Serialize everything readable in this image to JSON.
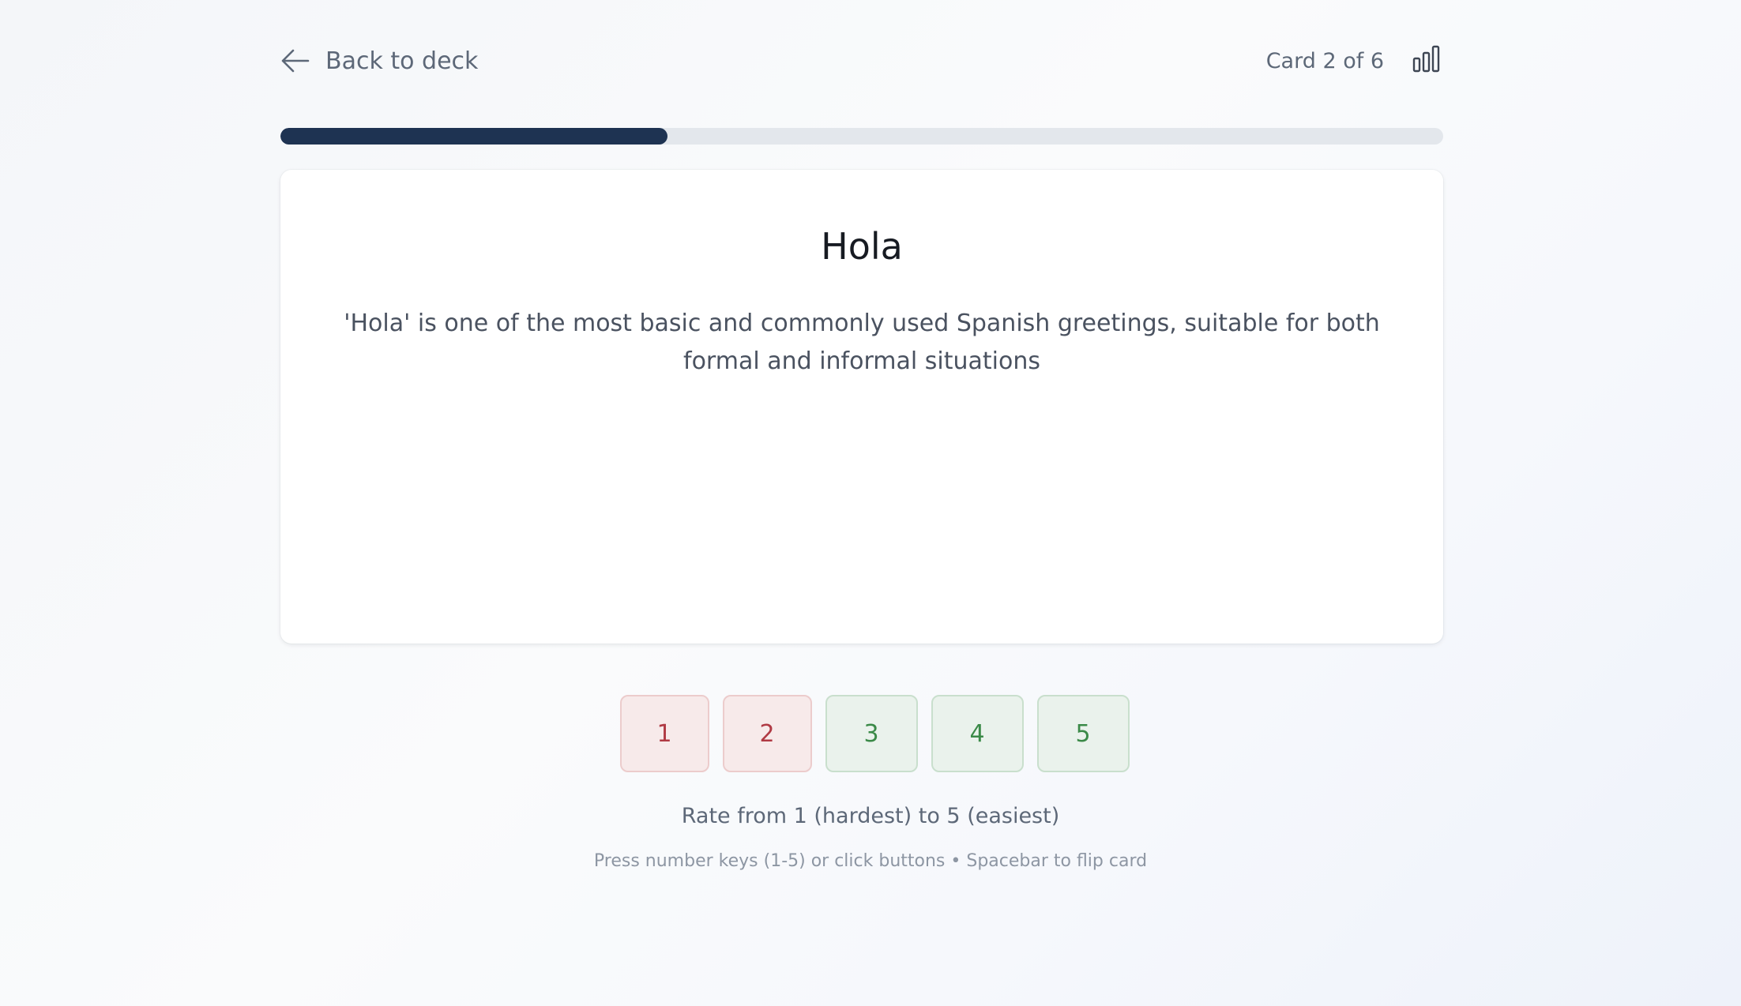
{
  "header": {
    "back_label": "Back to deck",
    "card_counter": "Card 2 of 6",
    "stats_icon": "bar-chart-icon",
    "back_icon": "arrow-left-icon"
  },
  "progress": {
    "current": 2,
    "total": 6,
    "fraction": 0.333
  },
  "card": {
    "term": "Hola",
    "definition": "'Hola' is one of the most basic and commonly used Spanish greetings, suitable for both formal and informal situations"
  },
  "rating": {
    "buttons": [
      {
        "label": "1",
        "tone": "hard"
      },
      {
        "label": "2",
        "tone": "hard"
      },
      {
        "label": "3",
        "tone": "easy"
      },
      {
        "label": "4",
        "tone": "easy"
      },
      {
        "label": "5",
        "tone": "easy"
      }
    ],
    "caption": "Rate from 1 (hardest) to 5 (easiest)",
    "hint": "Press number keys (1-5) or click buttons • Spacebar to flip card"
  },
  "colors": {
    "progress_fill": "#1e3352",
    "progress_track": "#e3e7ec",
    "hard_text": "#b03a44",
    "easy_text": "#3b8a48"
  }
}
